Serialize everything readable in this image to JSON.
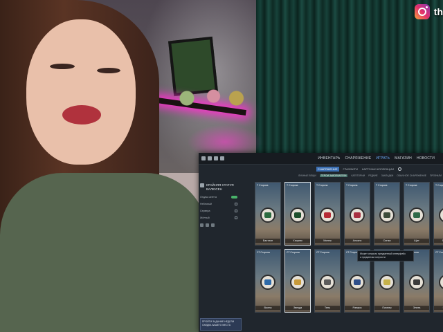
{
  "overlay": {
    "instagram_handle": "th",
    "instagram_icon": "instagram-icon"
  },
  "game": {
    "nav": [
      "ИНВЕНТАРЬ",
      "СНАРЯЖЕНИЕ",
      "ИГРАТЬ",
      "МАГАЗИН",
      "НОВОСТИ"
    ],
    "nav_active_index": 2,
    "sub_tabs": [
      "СНАРЯЖЕНИЕ",
      "ГРАФФИТИ",
      "КАРТОЧКИ КОЛЛЕКЦИИ"
    ],
    "filter_tabs": [
      "ЛИЧНЫЕ ВЕЩИ",
      "ГЕРОИ ЗАВОЕВАТЕЛИ",
      "КАТЕГОРИИ",
      "РЕДКИЕ",
      "ЗАКЛАДКИ",
      "ОБЫЧНОЕ СНАРЯЖЕНИЕ",
      "ПРОФИЛИ"
    ],
    "filter_active_index": 1,
    "sidebar": {
      "title": "КРАЙНЯЯ СТАТУЯ ВАЛЮСЕН",
      "toggle_label": "Отдача агента",
      "options": [
        "Небесный",
        "Сервера",
        "Жёлтый"
      ]
    },
    "cards": [
      {
        "tag": "T Сторона",
        "name": "Бастион",
        "emblem_color": "#2b6a3e"
      },
      {
        "tag": "T Сторона",
        "name": "Хищник",
        "emblem_color": "#1e4f2c"
      },
      {
        "tag": "T Сторона",
        "name": "Мятеж",
        "emblem_color": "#b52b36"
      },
      {
        "tag": "T Сторона",
        "name": "Альянс",
        "emblem_color": "#a83040"
      },
      {
        "tag": "T Сторона",
        "name": "Сигма",
        "emblem_color": "#3c4b3a"
      },
      {
        "tag": "T Сторона",
        "name": "Щит",
        "emblem_color": "#2f6a48"
      },
      {
        "tag": "T Сторона",
        "name": "Гранит",
        "emblem_color": "#3f5b3c"
      },
      {
        "tag": "CT Сторона",
        "name": "Волна",
        "emblem_color": "#2e6aa8"
      },
      {
        "tag": "CT Сторона",
        "name": "Звезда",
        "emblem_color": "#c79a3a"
      },
      {
        "tag": "CT Сторона",
        "name": "Тень",
        "emblem_color": "#5c5c5c"
      },
      {
        "tag": "CT Сторона",
        "name": "Рапира",
        "emblem_color": "#2e4e8a"
      },
      {
        "tag": "CT Сторона",
        "name": "Пионер",
        "emblem_color": "#c6b24a"
      },
      {
        "tag": "CT Сторона",
        "name": "Элита",
        "emblem_color": "#3a3a3a"
      },
      {
        "tag": "CT Сторона",
        "name": "Кобра",
        "emblem_color": "#b78a2c"
      }
    ],
    "tooltip": [
      "Может открыть предметный интерфейс",
      "к предметам хитрости"
    ],
    "bottom_button": [
      "ПРОЙТИ ЗАДАНИЕ НЕДЕЛИ",
      "СКИДКА ВАШЕГО МЕСТА"
    ]
  },
  "colors": {
    "accent": "#3b6fb3",
    "toggle_on": "#49b36a",
    "instagram_gradient": [
      "#f9a43c",
      "#e1306c",
      "#833ab4"
    ]
  }
}
